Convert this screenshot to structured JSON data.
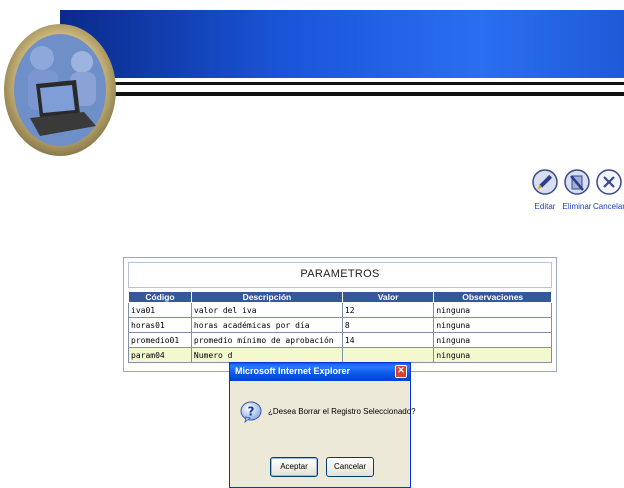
{
  "actions": {
    "edit_label": "Editar",
    "delete_label": "Eliminar",
    "cancel_label": "Cancelar"
  },
  "panel": {
    "title": "PARAMETROS",
    "columns": [
      "Código",
      "Descripción",
      "Valor",
      "Observaciones"
    ],
    "rows": [
      {
        "codigo": "iva01",
        "descripcion": "valor del iva",
        "valor": "12",
        "observaciones": "ninguna"
      },
      {
        "codigo": "horas01",
        "descripcion": "horas académicas por día",
        "valor": "8",
        "observaciones": "ninguna"
      },
      {
        "codigo": "promedio01",
        "descripcion": "promedio mínimo de aprobación",
        "valor": "14",
        "observaciones": "ninguna"
      },
      {
        "codigo": "param04",
        "descripcion": "Numero d",
        "valor": "",
        "observaciones": "ninguna"
      }
    ]
  },
  "dialog": {
    "title": "Microsoft Internet Explorer",
    "message": "¿Desea Borrar el Registro Seleccionado?",
    "ok_label": "Aceptar",
    "cancel_label": "Cancelar"
  },
  "colors": {
    "banner": "#1a55d8",
    "table_header": "#35589a",
    "selected_row": "#f3f8cf",
    "dialog_title": "#0a58e8"
  }
}
